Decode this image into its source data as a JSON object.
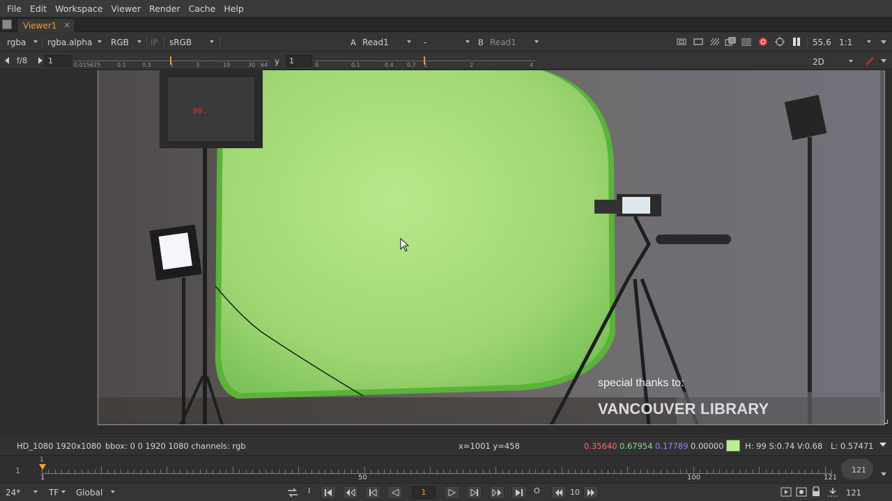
{
  "menu": [
    "File",
    "Edit",
    "Workspace",
    "Viewer",
    "Render",
    "Cache",
    "Help"
  ],
  "tab": {
    "label": "Viewer1",
    "close": "×"
  },
  "controls": {
    "channels": "rgba",
    "alpha": "rgba.alpha",
    "colorspace": "RGB",
    "ip": "IP",
    "lut": "sRGB",
    "a_label": "A",
    "a_input": "Read1",
    "operation": "-",
    "b_label": "B",
    "b_input": "Read1",
    "zoom": "55.6",
    "proxy": "1:1",
    "view_mode": "2D"
  },
  "exposure": {
    "fstop": "f/8",
    "gain_value": "1",
    "gain_ticks": [
      "0.015625",
      "0.1",
      "0.3",
      "1",
      "3",
      "10",
      "30",
      "64"
    ],
    "gamma_label": "y",
    "gamma_value": "1",
    "gamma_ticks": [
      "0",
      "0.1",
      "0.4",
      "0.7",
      "1",
      "2",
      "4"
    ]
  },
  "overlay": {
    "thanks": "special thanks to:",
    "library": "VANCOUVER LIBRARY"
  },
  "info": {
    "format": "HD_1080 1920x1080",
    "bbox": "bbox: 0 0 1920 1080 channels: rgb",
    "cursor_pos": "x=1001 y=458",
    "r": "0.35640",
    "g": "0.67954",
    "b": "0.17789",
    "a": "0.00000",
    "hsv": "H: 99 S:0.74 V:0.68",
    "luma": "L: 0.57471",
    "swatch_color": "#b7f08e"
  },
  "timeline": {
    "in_frame": "1",
    "playhead_label": "1",
    "labels": [
      "1",
      "50",
      "100",
      "121"
    ],
    "end_frame": "121"
  },
  "playback": {
    "fps": "24*",
    "tf": "TF",
    "range": "Global",
    "in_marker": "I",
    "current_frame": "1",
    "out_marker": "O",
    "step": "10",
    "end_frame": "121"
  },
  "colors": {
    "accent": "#f29c38",
    "red_value": "#ff6a6a",
    "green_value": "#7fe27f",
    "blue_value": "#8a8aff"
  }
}
